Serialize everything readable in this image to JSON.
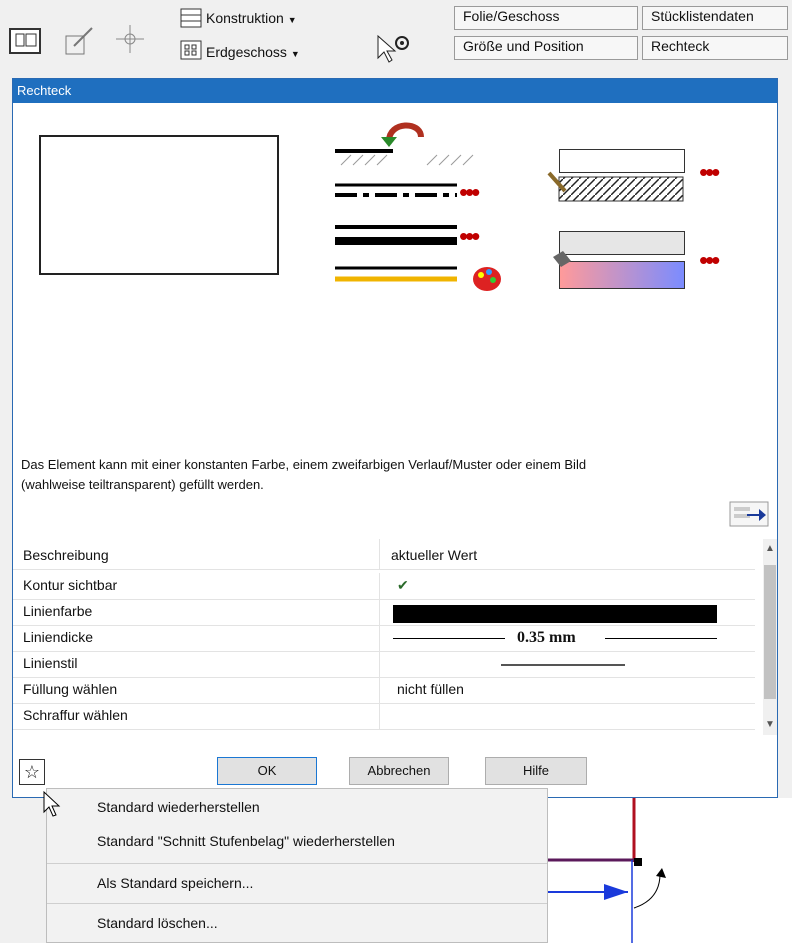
{
  "toolbar": {
    "dropdown_construction": "Konstruktion",
    "dropdown_floor": "Erdgeschoss",
    "tabs": [
      "Folie/Geschoss",
      "Stücklistendaten",
      "Größe und Position",
      "Rechteck"
    ],
    "icons": [
      "layers-icon",
      "brush-icon",
      "move-icon",
      "construction-icon",
      "floor-icon",
      "pointer-gear-icon"
    ]
  },
  "dialog": {
    "title": "Rechteck",
    "description_line1": "Das Element kann mit einer konstanten Farbe, einem zweifarbigen Verlauf/Muster oder einem Bild",
    "description_line2": "(wahlweise teiltransparent) gefüllt werden.",
    "table": {
      "header_desc": "Beschreibung",
      "header_val": "aktueller Wert",
      "rows": [
        {
          "label": "Kontur sichtbar",
          "value": "✔"
        },
        {
          "label": "Linienfarbe",
          "value": ""
        },
        {
          "label": "Liniendicke",
          "value": "0.35 mm"
        },
        {
          "label": "Linienstil",
          "value": ""
        },
        {
          "label": "Füllung wählen",
          "value": "nicht füllen"
        },
        {
          "label": "Schraffur wählen",
          "value": ""
        }
      ]
    },
    "buttons": {
      "ok": "OK",
      "cancel": "Abbrechen",
      "help": "Hilfe"
    },
    "colors": {
      "titlebar": "#1f6fbf",
      "line_color": "#000000",
      "dots": "#c00000",
      "gradient_from": "#ff9a9a",
      "gradient_to": "#7b8cff"
    }
  },
  "context_menu": {
    "items": [
      "Standard wiederherstellen",
      "Standard \"Schnitt Stufenbelag\" wiederherstellen",
      "Als Standard speichern...",
      "Standard löschen..."
    ]
  }
}
